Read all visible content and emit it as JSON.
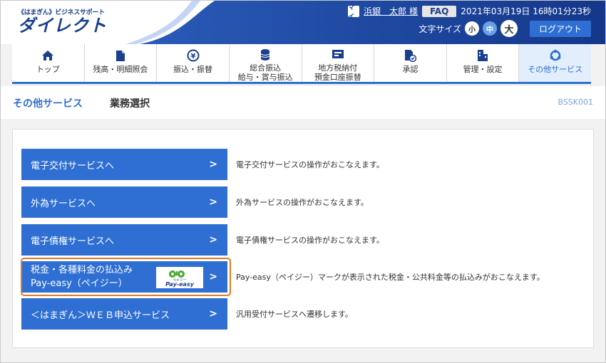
{
  "header": {
    "logo_sub": "《はまぎん》ビジネスサポート",
    "logo_main": "ダイレクト",
    "user_icon": "マイ",
    "user_name": "浜銀　太郎 様",
    "faq": "FAQ",
    "datetime": "2021年03月19日 16時01分23秒",
    "font_size_label": "文字サイズ",
    "font_small": "小",
    "font_medium": "中",
    "font_large": "大",
    "logout": "ログアウト"
  },
  "nav": {
    "items": [
      {
        "line1": "トップ",
        "line2": "",
        "icon": "home-icon"
      },
      {
        "line1": "残高・明細照会",
        "line2": "",
        "icon": "document-icon"
      },
      {
        "line1": "振込・振替",
        "line2": "",
        "icon": "yen-transfer-icon"
      },
      {
        "line1": "総合振込",
        "line2": "給与・賞与振込",
        "icon": "coins-icon"
      },
      {
        "line1": "地方税納付",
        "line2": "預金口座振替",
        "icon": "tax-icon"
      },
      {
        "line1": "承認",
        "line2": "",
        "icon": "approval-icon"
      },
      {
        "line1": "管理・設定",
        "line2": "",
        "icon": "management-icon"
      },
      {
        "line1": "その他サービス",
        "line2": "",
        "icon": "other-services-icon"
      }
    ],
    "active_index": 7
  },
  "titlebar": {
    "section": "その他サービス",
    "page": "業務選択",
    "code": "BSSK001"
  },
  "services": [
    {
      "label": "電子交付サービスへ",
      "desc": "電子交付サービスの操作がおこなえます。"
    },
    {
      "label": "外為サービスへ",
      "desc": "外為サービスの操作がおこなえます。"
    },
    {
      "label": "電子債権サービスへ",
      "desc": "電子債権サービスの操作がおこなえます。"
    },
    {
      "label_line1": "税金・各種料金の払込み",
      "label_line2": "Pay-easy（ペイジー）",
      "desc": "Pay-easy（ペイジー）マークが表示された税金・公共料金等の払込みがおこなえます。",
      "logo_text": "ペイジー",
      "logo_main": "Pay-easy"
    },
    {
      "label": "＜はまぎん＞ＷＥＢ申込サービス",
      "desc": "汎用受付サービスへ遷移します。"
    }
  ],
  "colors": {
    "primary": "#2f6fd3",
    "header_dark": "#1a3f8e",
    "highlight": "#e07a1f"
  }
}
